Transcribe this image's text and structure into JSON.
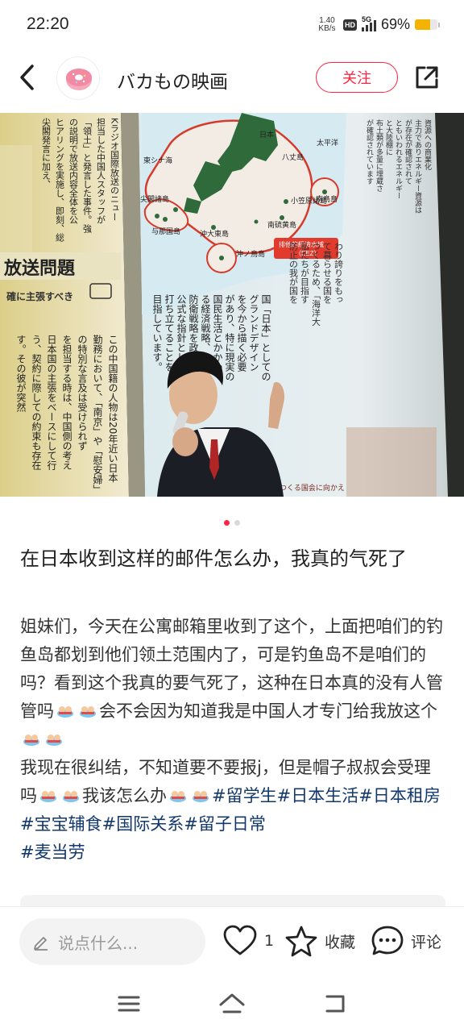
{
  "status_bar": {
    "time": "22:20",
    "net_speed_value": "1.40",
    "net_speed_unit": "KB/s",
    "hd_badge": "HD",
    "network": "5G",
    "battery_pct": "69%",
    "battery_level": 0.69
  },
  "header": {
    "author_name": "バカもの映画",
    "follow_label": "关注"
  },
  "photo": {
    "map_labels": {
      "east_china_sea": "東シナ海",
      "japan": "日本",
      "hachijojima": "八丈島",
      "pacific": "太平洋",
      "senkaku": "尖閣諸島",
      "yonaguni": "与那国島",
      "okidaito": "沖大東島",
      "ogasawara": "小笠原諸島",
      "minamitorishima": "南鳥島",
      "minamiiwojima": "南硫黄島",
      "okinotorishima": "沖ノ鳥島",
      "eez_line1": "排他的経済水域",
      "eez_line2": "（EEZ）"
    },
    "left_page": {
      "header_lines": [
        "Kラジオ国際放送のニュー",
        "担当した中国人スタッフが",
        "「領土」と発言した事件。強",
        "の説明で放送内容全体を公",
        "ヒアリングを実施し、即刻、総",
        "尖閣発言に加え、"
      ],
      "heading": "放送問題",
      "subheading": "確に主張すべき",
      "body_lines": [
        "この中国籍の人物は20年近い日本",
        "勤務において、「南京」や「慰安婦」",
        "の特別な言及は受けられず",
        "を担当する時は、中国側の考え",
        "日本国の主張をベースにして行",
        "う、契約に際しての約束も存在",
        "す。その彼が突然"
      ]
    },
    "right_page": {
      "main_lines": [
        "国「日本」としての",
        "グランドデザイン",
        "を今から描く必要",
        "があり、特に現実の",
        "国民生活とかかわ",
        "る経済戦略、そして",
        "防衛戦略を政府の",
        "公式な指針として",
        "打ち立てることを",
        "目指しています。"
      ],
      "upper_lines": [
        "わり誇りをもっ",
        "て暮らせる国を",
        "つくるため、「海洋大",
        "私たちが目指す",
        "防止の我が国を"
      ],
      "column_lines": [
        "資源への商業化",
        "主力でありエネルギー資源は",
        "が存在が確認されて",
        "ともいわれるエネルギー",
        "と大陸棚に",
        "布土類が多量に埋蔵さ",
        "が確認されています"
      ],
      "margin_text": "祖国をつくる国会に向かえ"
    }
  },
  "post": {
    "title": "在日本收到这样的邮件怎么办，我真的气死了",
    "body_line1": "姐妹们，今天在公寓邮箱里收到了这个，上面把咱们的钓鱼岛都划到他们领土范围内了，可是钓鱼岛不是咱们的吗？看到这个我真的要气死了，这种在日本真的没有人管管吗",
    "body_line2": "会不会因为知道我是中国人才专门给我放这个",
    "body_line3": "我现在很纠结，不知道要不要报j，但是帽子叔叔会受理吗",
    "body_line4": "我该怎么办",
    "tags": [
      "#留学生",
      "#日本生活",
      "#日本租房",
      "#宝宝辅食",
      "#国际关系",
      "#留子日常",
      "#麦当劳"
    ]
  },
  "bottom_bar": {
    "comment_placeholder": "说点什么...",
    "like_count": "1",
    "collect_label": "收藏",
    "comment_label": "评论"
  },
  "carousel": {
    "total": 2,
    "current": 1
  },
  "colors": {
    "accent": "#ff2442",
    "tag": "#13386c",
    "battery": "#f5b301"
  },
  "icons": [
    "back-icon",
    "share-icon",
    "pencil-icon",
    "heart-icon",
    "star-icon",
    "comment-icon",
    "menu-icon",
    "home-icon",
    "return-icon"
  ]
}
